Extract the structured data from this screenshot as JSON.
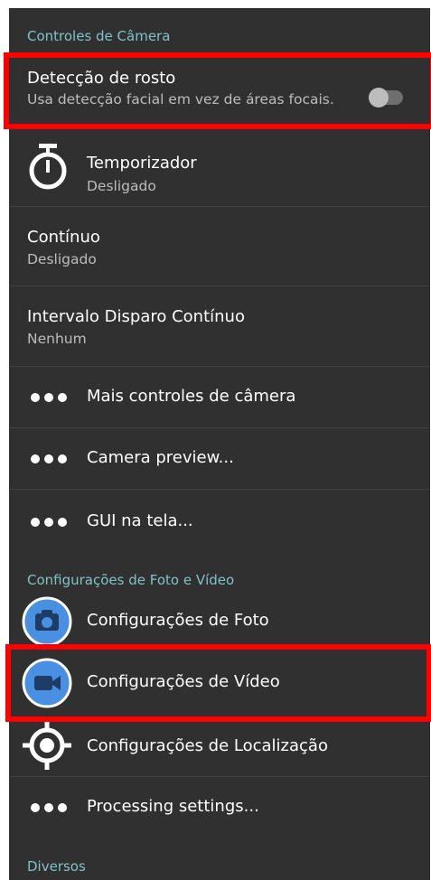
{
  "sections": {
    "camera_controls": "Controles de Câmera",
    "photo_video": "Configurações de Foto e Vídeo",
    "misc": "Diversos"
  },
  "face_detection": {
    "title": "Detecção de rosto",
    "subtitle": "Usa detecção facial em vez de áreas focais.",
    "toggle_on": false
  },
  "timer": {
    "title": "Temporizador",
    "subtitle": "Desligado"
  },
  "continuous": {
    "title": "Contínuo",
    "subtitle": "Desligado"
  },
  "burst_interval": {
    "title": "Intervalo Disparo Contínuo",
    "subtitle": "Nenhum"
  },
  "more_camera_controls": {
    "title": "Mais controles de câmera"
  },
  "camera_preview": {
    "title": "Camera preview..."
  },
  "on_screen_gui": {
    "title": "GUI na tela..."
  },
  "photo_settings": {
    "title": "Configurações de Foto"
  },
  "video_settings": {
    "title": "Configurações de Vídeo"
  },
  "location_settings": {
    "title": "Configurações de Localização"
  },
  "processing_settings": {
    "title": "Processing settings..."
  },
  "colors": {
    "background": "#303030",
    "section_header": "#7fc3c8",
    "icon_accent": "#4a90e2",
    "highlight": "#ff0000"
  },
  "icons": {
    "timer": "stopwatch-icon",
    "more": "more-dots-icon",
    "photo": "camera-icon",
    "video": "video-camera-icon",
    "location": "location-crosshair-icon"
  }
}
